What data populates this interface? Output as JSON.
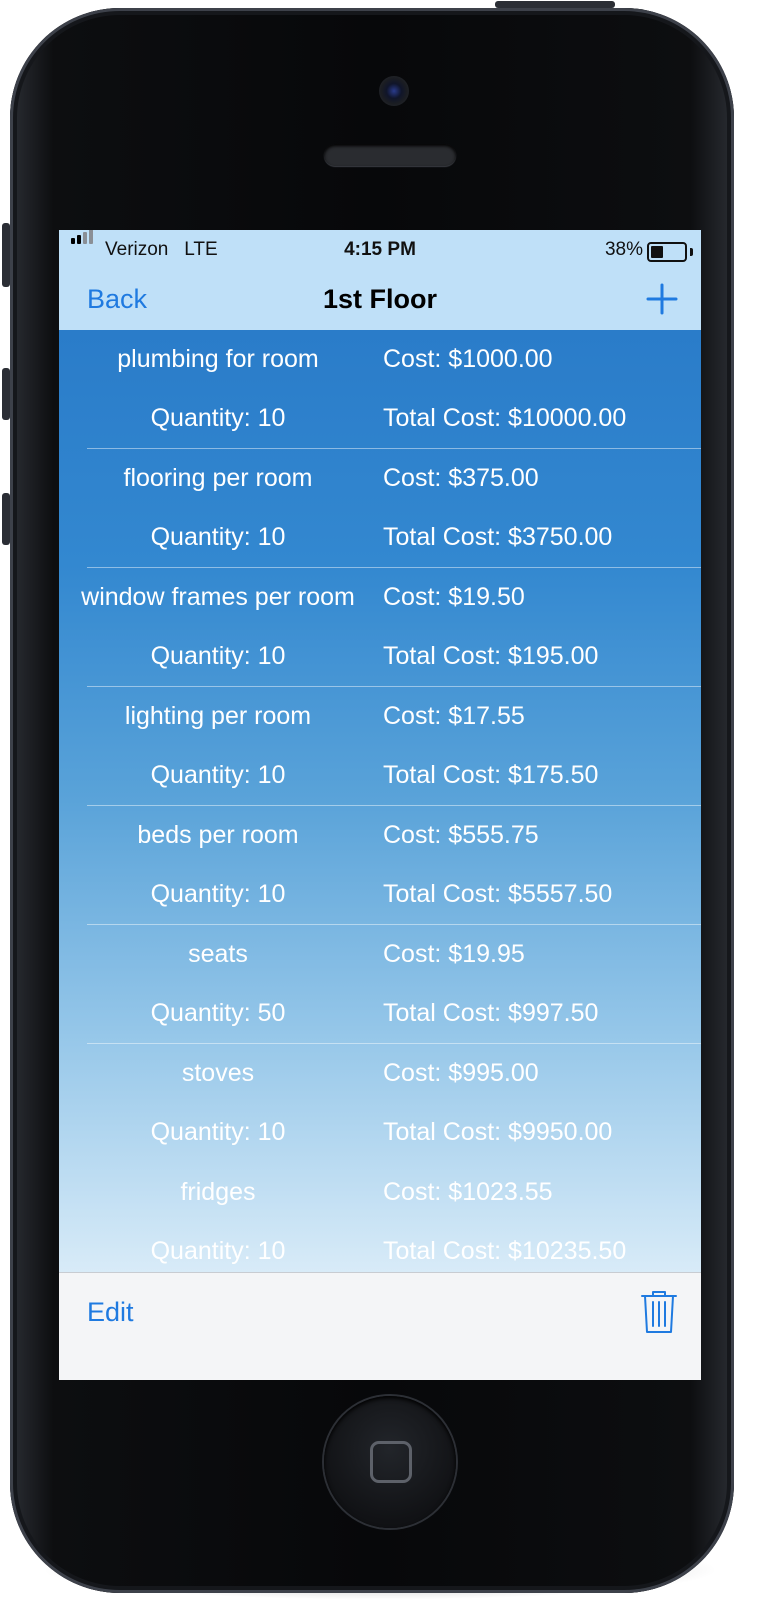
{
  "status_bar": {
    "carrier": "Verizon   LTE",
    "time": "4:15 PM",
    "battery_percent": "38%",
    "battery_level": 0.38
  },
  "nav": {
    "back_label": "Back",
    "title": "1st Floor",
    "add_icon": "plus-icon"
  },
  "items": [
    {
      "name": "plumbing for room",
      "quantity": "Quantity: 10",
      "cost": "Cost: $1000.00",
      "total": "Total Cost: $10000.00"
    },
    {
      "name": "flooring per room",
      "quantity": "Quantity: 10",
      "cost": "Cost: $375.00",
      "total": "Total Cost: $3750.00"
    },
    {
      "name": "window frames per room",
      "quantity": "Quantity: 10",
      "cost": "Cost: $19.50",
      "total": "Total Cost: $195.00"
    },
    {
      "name": "lighting per room",
      "quantity": "Quantity: 10",
      "cost": "Cost: $17.55",
      "total": "Total Cost: $175.50"
    },
    {
      "name": "beds per room",
      "quantity": "Quantity: 10",
      "cost": "Cost: $555.75",
      "total": "Total Cost: $5557.50"
    },
    {
      "name": "seats",
      "quantity": "Quantity: 50",
      "cost": "Cost: $19.95",
      "total": "Total Cost: $997.50"
    },
    {
      "name": "stoves",
      "quantity": "Quantity: 10",
      "cost": "Cost: $995.00",
      "total": "Total Cost: $9950.00"
    },
    {
      "name": "fridges",
      "quantity": "Quantity: 10",
      "cost": "Cost: $1023.55",
      "total": "Total Cost: $10235.50"
    }
  ],
  "toolbar": {
    "edit_label": "Edit",
    "trash_icon": "trash-icon"
  },
  "colors": {
    "accent": "#1f7ae0",
    "nav_background": "#bfe0f8",
    "list_top": "#2a7cc9",
    "list_bottom": "#d8ebf8"
  }
}
